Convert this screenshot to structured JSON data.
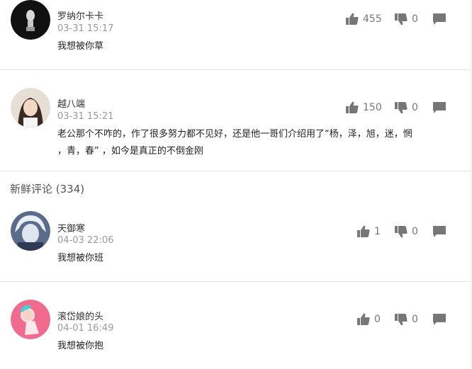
{
  "hot_comments": [
    {
      "user": "罗纳尔卡卡",
      "time": "03-31 15:17",
      "text": "我想被你草",
      "up": "455",
      "down": "0",
      "avatar_icon": "dark-avatar-icon"
    },
    {
      "user": "越八端",
      "time": "03-31 15:21",
      "text_line1": "老公那个不咋的，作了很多努力都不见好，还是他一哥们介绍用了“杨，泽，旭，迷，惘",
      "text_line2": "，青，春”   ，如今是真正的不倒金刚",
      "up": "150",
      "down": "0",
      "avatar_icon": "girl-avatar-icon"
    }
  ],
  "new_section": {
    "title": "新鲜评论 (334)"
  },
  "new_comments": [
    {
      "user": "天御寒",
      "time": "04-03 22:06",
      "text": "我想被你班",
      "up": "1",
      "down": "0",
      "avatar_icon": "anime-avatar-icon"
    },
    {
      "user": "滚岱娘的头",
      "time": "04-01 16:49",
      "text": "我想被你抱",
      "up": "0",
      "down": "0",
      "avatar_icon": "pink-avatar-icon"
    }
  ]
}
